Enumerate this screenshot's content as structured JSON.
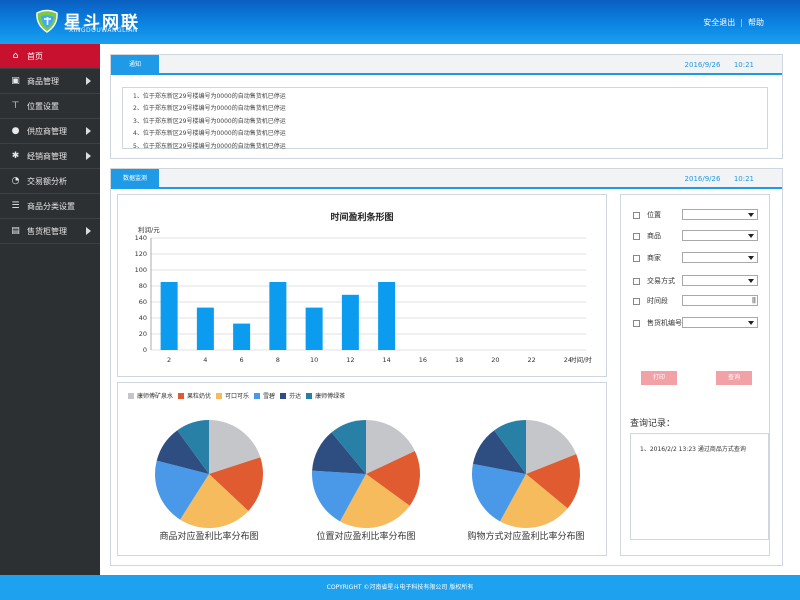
{
  "header": {
    "brand": "星斗网联",
    "brand_sub": "XINGDOUWANGLIAN",
    "logout": "安全退出",
    "separator": "|",
    "help": "帮助"
  },
  "sidebar": {
    "items": [
      {
        "label": "首页",
        "icon": "home-icon",
        "active": true,
        "has_arrow": false
      },
      {
        "label": "商品管理",
        "icon": "box-icon",
        "active": false,
        "has_arrow": true
      },
      {
        "label": "位置设置",
        "icon": "signpost-icon",
        "active": false,
        "has_arrow": false
      },
      {
        "label": "供应商管理",
        "icon": "user-icon",
        "active": false,
        "has_arrow": true
      },
      {
        "label": "经销商管理",
        "icon": "network-icon",
        "active": false,
        "has_arrow": true
      },
      {
        "label": "交易额分析",
        "icon": "pie-icon",
        "active": false,
        "has_arrow": false
      },
      {
        "label": "商品分类设置",
        "icon": "list-icon",
        "active": false,
        "has_arrow": false
      },
      {
        "label": "售货柜管理",
        "icon": "cabinet-icon",
        "active": false,
        "has_arrow": true
      }
    ]
  },
  "notice": {
    "tab": "通知",
    "date": "2016/9/26",
    "time": "10:21",
    "items": [
      "1、位于郑东新区29号楼编号为0000的自动售货机已停运",
      "2、位于郑东新区29号楼编号为0000的自动售货机已停运",
      "3、位于郑东新区29号楼编号为0000的自动售货机已停运",
      "4、位于郑东新区29号楼编号为0000的自动售货机已停运",
      "5、位于郑东新区29号楼编号为0000的自动售货机已停运"
    ]
  },
  "monitor": {
    "tab": "数据监测",
    "date": "2016/9/26",
    "time": "10:21"
  },
  "chart_data": [
    {
      "type": "bar",
      "title": "时间盈利条形图",
      "ylabel": "利润/元",
      "xlabel": "时间/时",
      "ylim": [
        0,
        140
      ],
      "yticks": [
        0,
        20,
        40,
        60,
        80,
        100,
        120,
        140
      ],
      "categories": [
        "2",
        "4",
        "6",
        "8",
        "10",
        "12",
        "14",
        "16",
        "18",
        "20",
        "22",
        "24"
      ],
      "values": [
        85,
        53,
        33,
        85,
        53,
        69,
        85,
        null,
        null,
        null,
        null,
        null
      ],
      "grid": true,
      "color": "#0b9cf0"
    },
    {
      "type": "pie",
      "title": "商品对应盈利比率分布图",
      "legend": [
        "康师傅矿泉水",
        "果粒奶优",
        "可口可乐",
        "雪碧",
        "芬达",
        "康师傅绿茶"
      ],
      "colors": [
        "#c4c6c9",
        "#e05b2f",
        "#f5bb5c",
        "#4a98e8",
        "#2e4d80",
        "#2880a6"
      ],
      "values": [
        20,
        17,
        22,
        20,
        11,
        10
      ]
    },
    {
      "type": "pie",
      "title": "位置对应盈利比率分布图",
      "legend": [
        "康师傅矿泉水",
        "果粒奶优",
        "可口可乐",
        "雪碧",
        "芬达",
        "康师傅绿茶"
      ],
      "colors": [
        "#c4c6c9",
        "#e05b2f",
        "#f5bb5c",
        "#4a98e8",
        "#2e4d80",
        "#2880a6"
      ],
      "values": [
        18,
        17,
        23,
        18,
        13,
        11
      ]
    },
    {
      "type": "pie",
      "title": "购物方式对应盈利比率分布图",
      "legend": [
        "康师傅矿泉水",
        "果粒奶优",
        "可口可乐",
        "雪碧",
        "芬达",
        "康师傅绿茶"
      ],
      "colors": [
        "#c4c6c9",
        "#e05b2f",
        "#f5bb5c",
        "#4a98e8",
        "#2e4d80",
        "#2880a6"
      ],
      "values": [
        19,
        17,
        22,
        20,
        12,
        10
      ]
    }
  ],
  "filters": {
    "location": "位置",
    "product": "商品",
    "merchant": "商家",
    "payment": "交易方式",
    "period": "时间段",
    "machine": "售货机编号",
    "print_button": "打印",
    "query_button": "查询",
    "records_title": "查询记录：",
    "record_items": [
      "1、2016/2/2  13:23  通过商品方式查询"
    ]
  },
  "footer": {
    "copyright": "COPYRIGHT ©河南省星斗电子科技有限公司 版权所有"
  }
}
